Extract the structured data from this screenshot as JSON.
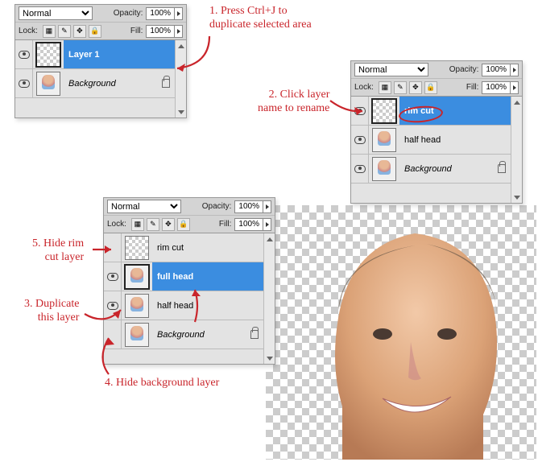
{
  "common": {
    "blend_mode": "Normal",
    "opacity_label": "Opacity:",
    "opacity_value": "100%",
    "lock_label": "Lock:",
    "fill_label": "Fill:",
    "fill_value": "100%"
  },
  "panel1": {
    "layers": [
      {
        "name": "Layer 1",
        "visible": true,
        "selected": true,
        "thumb": "checker",
        "bold": true
      },
      {
        "name": "Background",
        "visible": true,
        "selected": false,
        "thumb": "head",
        "locked": true,
        "italic": true
      }
    ]
  },
  "panel2": {
    "layers": [
      {
        "name": "rim cut",
        "visible": true,
        "selected": true,
        "thumb": "checker",
        "bold": true
      },
      {
        "name": "half head",
        "visible": true,
        "selected": false,
        "thumb": "head"
      },
      {
        "name": "Background",
        "visible": true,
        "selected": false,
        "thumb": "head",
        "locked": true,
        "italic": true
      }
    ]
  },
  "panel3": {
    "layers": [
      {
        "name": "rim cut",
        "visible": false,
        "selected": false,
        "thumb": "checker"
      },
      {
        "name": "full head",
        "visible": true,
        "selected": true,
        "thumb": "head",
        "bold": true
      },
      {
        "name": "half head",
        "visible": true,
        "selected": false,
        "thumb": "head"
      },
      {
        "name": "Background",
        "visible": false,
        "selected": false,
        "thumb": "head",
        "locked": true,
        "italic": true
      }
    ]
  },
  "annotations": {
    "a1": "1. Press Ctrl+J to\nduplicate selected area",
    "a2": "2. Click layer\nname to rename",
    "a3": "3. Duplicate\nthis layer",
    "a4": "4. Hide background layer",
    "a5": "5. Hide rim\ncut layer"
  }
}
